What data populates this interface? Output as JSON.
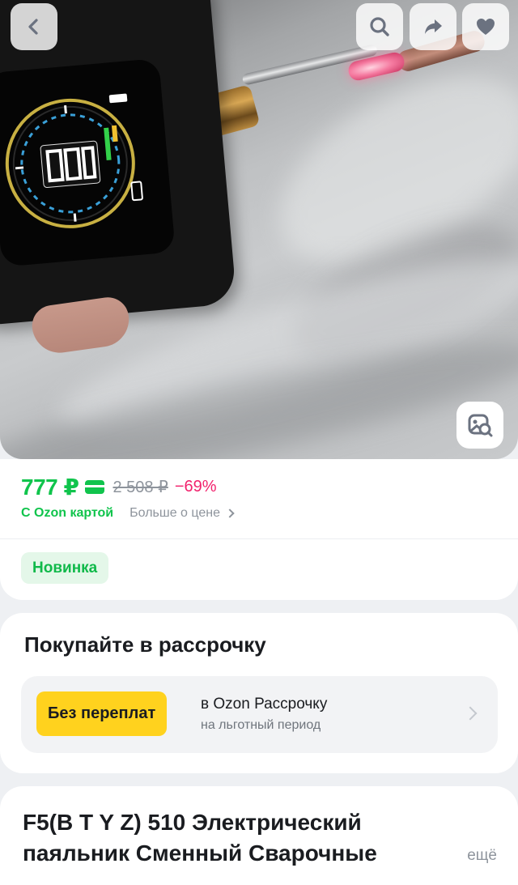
{
  "header_buttons": {
    "back_icon": "chevron-left-icon",
    "search_icon": "search-icon",
    "share_icon": "share-arrow-icon",
    "favorite_icon": "heart-icon",
    "image_search_icon": "image-search-icon"
  },
  "price": {
    "current": "777 ₽",
    "old": "2 508 ₽",
    "discount": "−69%",
    "card_label": "С Ozon картой",
    "more_link": "Больше о цене",
    "color_green": "#10c44c",
    "color_discount": "#f2226d"
  },
  "badge": {
    "label": "Новинка"
  },
  "installment": {
    "title": "Покупайте в рассрочку",
    "button_label": "Без переплат",
    "line1": "в Ozon Рассрочку",
    "line2": "на льготный период",
    "button_color": "#ffd21e"
  },
  "product": {
    "title": "F5(B T Y Z) 510 Электрический паяльник Сменный Сварочные",
    "more_label": "ещё"
  }
}
